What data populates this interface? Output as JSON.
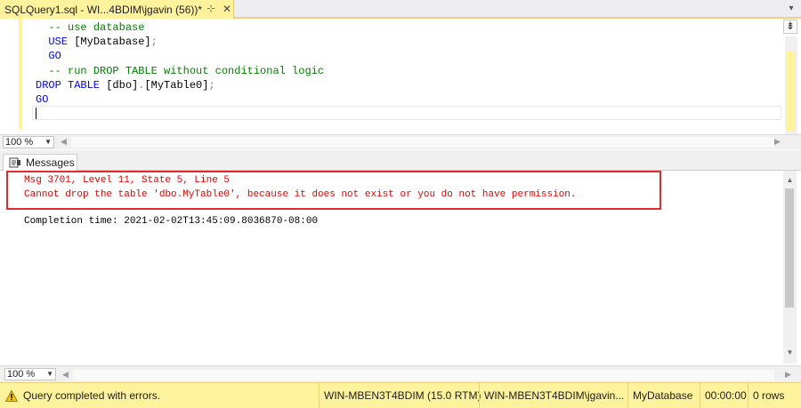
{
  "tab": {
    "title": "SQLQuery1.sql - WI...4BDIM\\jgavin (56))*",
    "pin_glyph": "⊹",
    "close_glyph": "✕"
  },
  "editor": {
    "lines": [
      {
        "kind": "comment",
        "text": "-- use database"
      },
      {
        "kind": "use",
        "kw": "USE",
        "rest": " [MyDatabase]",
        "punct": ";"
      },
      {
        "kind": "keyword",
        "text": "GO"
      },
      {
        "kind": "comment",
        "text": "-- run DROP TABLE without conditional logic"
      },
      {
        "kind": "drop",
        "kw": "DROP TABLE",
        "a": " [dbo]",
        "dot": ".",
        "b": "[MyTable0]",
        "punct": ";"
      },
      {
        "kind": "keyword",
        "text": "GO"
      }
    ]
  },
  "zoom": {
    "editor": "100 %",
    "messages": "100 %"
  },
  "results": {
    "messages_tab": "Messages"
  },
  "messages": {
    "error_line1": "Msg 3701, Level 11, State 5, Line 5",
    "error_line2": "Cannot drop the table 'dbo.MyTable0', because it does not exist or you do not have permission.",
    "completion": "Completion time: 2021-02-02T13:45:09.8036870-08:00"
  },
  "status": {
    "message": "Query completed with errors.",
    "server": "WIN-MBEN3T4BDIM (15.0 RTM)",
    "user": "WIN-MBEN3T4BDIM\\jgavin...",
    "database": "MyDatabase",
    "elapsed": "00:00:00",
    "rows": "0 rows"
  },
  "colors": {
    "accent": "#fff29d",
    "error": "#e32b2b",
    "comment": "#008000",
    "keyword": "#0000ff"
  }
}
